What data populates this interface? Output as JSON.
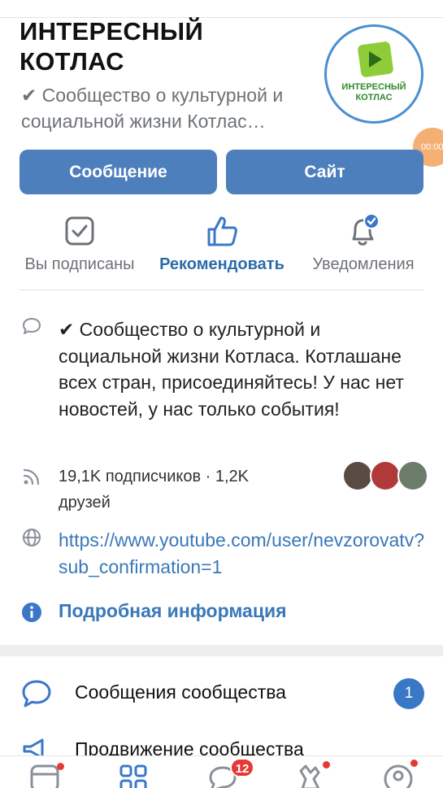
{
  "header": {
    "title": "ИНТЕРЕСНЫЙ КОТЛАС",
    "status": "✔ Сообщество о культурной и социальной жизни Котлас…",
    "avatar_text": "ИНТЕРЕСНЫЙ КОТЛАС",
    "timer": "00:00"
  },
  "buttons": {
    "message": "Сообщение",
    "site": "Сайт"
  },
  "actions": [
    {
      "label": "Вы подписаны",
      "icon": "check-square-icon"
    },
    {
      "label": "Рекомендовать",
      "icon": "thumbs-up-icon"
    },
    {
      "label": "Уведомления",
      "icon": "bell-icon"
    }
  ],
  "info": {
    "description": "✔ Сообщество о культурной и социальной жизни Котласа. Котлашане всех стран, присоединяйтесь! У нас нет новостей, у нас только события!",
    "followers": "19,1K подписчиков · 1,2K друзей",
    "link": "https://www.youtube.com/user/nevzorovatv?sub_confirmation=1",
    "more": "Подробная информация"
  },
  "menu": {
    "messages": "Сообщения сообщества",
    "messages_badge": "1",
    "promotion": "Продвижение сообщества"
  },
  "tabbar": {
    "messenger_count": "12"
  },
  "colors": {
    "accent": "#4d7fbd",
    "link": "#3a78b8",
    "notification": "#e53935"
  }
}
